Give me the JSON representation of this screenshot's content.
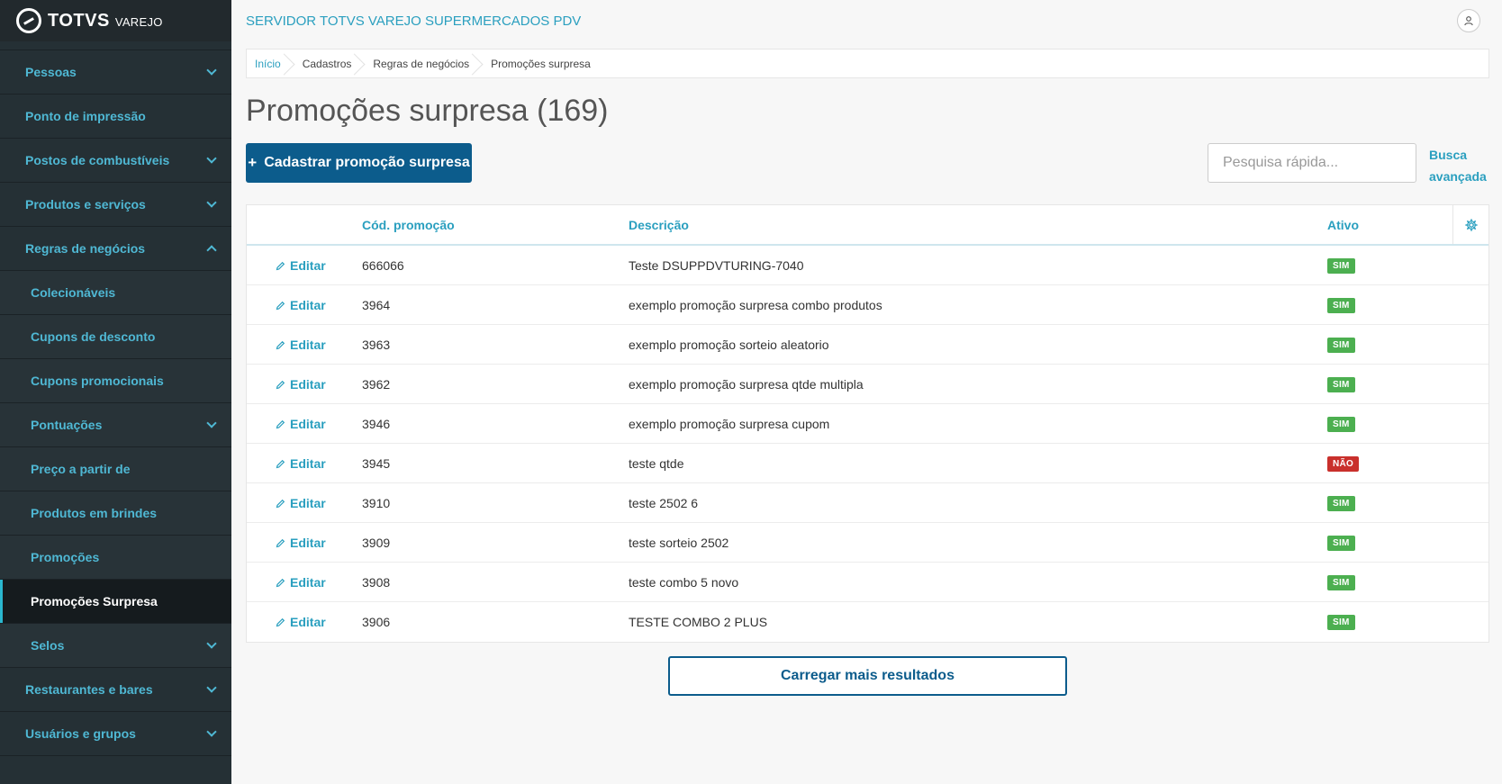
{
  "brand": {
    "logo": "TOTVS",
    "logo_sub": "VAREJO"
  },
  "sidebar": {
    "items": [
      {
        "label": "Pessoas",
        "expandable": true,
        "sub": false
      },
      {
        "label": "Ponto de impressão",
        "expandable": false,
        "sub": false
      },
      {
        "label": "Postos de combustíveis",
        "expandable": true,
        "sub": false
      },
      {
        "label": "Produtos e serviços",
        "expandable": true,
        "sub": false
      },
      {
        "label": "Regras de negócios",
        "expandable": true,
        "expanded": true,
        "sub": false
      },
      {
        "label": "Colecionáveis",
        "expandable": false,
        "sub": true
      },
      {
        "label": "Cupons de desconto",
        "expandable": false,
        "sub": true
      },
      {
        "label": "Cupons promocionais",
        "expandable": false,
        "sub": true
      },
      {
        "label": "Pontuações",
        "expandable": true,
        "sub": true
      },
      {
        "label": "Preço a partir de",
        "expandable": false,
        "sub": true
      },
      {
        "label": "Produtos em brindes",
        "expandable": false,
        "sub": true
      },
      {
        "label": "Promoções",
        "expandable": false,
        "sub": true
      },
      {
        "label": "Promoções Surpresa",
        "expandable": false,
        "sub": true,
        "active": true
      },
      {
        "label": "Selos",
        "expandable": true,
        "sub": true
      },
      {
        "label": "Restaurantes e bares",
        "expandable": true,
        "sub": false
      },
      {
        "label": "Usuários e grupos",
        "expandable": true,
        "sub": false
      }
    ]
  },
  "header": {
    "server_title": "SERVIDOR TOTVS VAREJO SUPERMERCADOS PDV",
    "user_icon": "user-icon"
  },
  "breadcrumb": [
    "Início",
    "Cadastros",
    "Regras de negócios",
    "Promoções surpresa"
  ],
  "page": {
    "title": "Promoções surpresa (169)",
    "add_button": "Cadastrar promoção surpresa",
    "search_placeholder": "Pesquisa rápida...",
    "advanced_search_line1": "Busca",
    "advanced_search_line2": "avançada",
    "load_more": "Carregar mais resultados"
  },
  "table": {
    "columns": {
      "code": "Cód. promoção",
      "description": "Descrição",
      "active": "Ativo"
    },
    "edit_label": "Editar",
    "rows": [
      {
        "code": "666066",
        "description": "Teste DSUPPDVTURING-7040",
        "active": "SIM"
      },
      {
        "code": "3964",
        "description": "exemplo promoção surpresa combo produtos",
        "active": "SIM"
      },
      {
        "code": "3963",
        "description": "exemplo promoção sorteio aleatorio",
        "active": "SIM"
      },
      {
        "code": "3962",
        "description": "exemplo promoção surpresa qtde multipla",
        "active": "SIM"
      },
      {
        "code": "3946",
        "description": "exemplo promoção surpresa cupom",
        "active": "SIM"
      },
      {
        "code": "3945",
        "description": "teste qtde",
        "active": "NÃO"
      },
      {
        "code": "3910",
        "description": "teste 2502 6",
        "active": "SIM"
      },
      {
        "code": "3909",
        "description": "teste sorteio 2502",
        "active": "SIM"
      },
      {
        "code": "3908",
        "description": "teste combo 5 novo",
        "active": "SIM"
      },
      {
        "code": "3906",
        "description": "TESTE COMBO 2 PLUS",
        "active": "SIM"
      }
    ]
  },
  "colors": {
    "accent": "#2a9fbf",
    "primary": "#0c5c8c",
    "yes": "#4caf50",
    "no": "#c9302c",
    "sidebar_bg": "#253035"
  }
}
